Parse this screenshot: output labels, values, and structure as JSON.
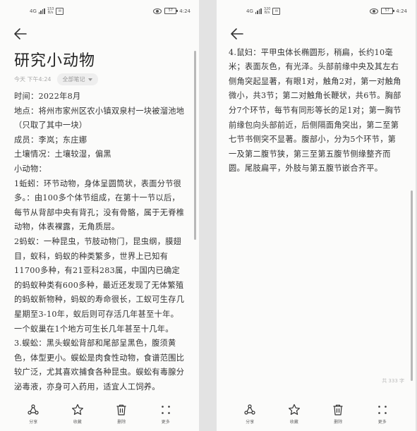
{
  "status": {
    "network": "4G",
    "speed_value": "153",
    "speed_unit": "B/s",
    "speed_value_right": "320",
    "time": "4:24",
    "battery": "57"
  },
  "note": {
    "title": "研究小动物",
    "date": "今天 下午4:24",
    "category": "全部笔记",
    "lines": [
      "时间：2022年8月",
      "地点：将州市家州区农小镇双泉村一块被溜池地（只取了其中一块）",
      "成员：李岚；东庄娜",
      "土壤情况：土壤较湿，偏黑",
      "小动物：",
      "1蚯蚓：环节动物，身体呈圆筒状，表面分节很多。：由100多个体节组成，在第十一节以后，每节从背部中央有背孔；没有骨骼，属于无脊椎动物，体表裸露，无角质层。",
      "2蚂蚁：一种昆虫，节肢动物门，昆虫纲，膜翅目，蚁科，蚂蚁的种类繁多，世界上已知有11700多种，有21亚科283属，中国内已确定的蚂蚁种类有600多种，最近还发现了无体繁殖的蚂蚁新物种，蚂蚁的寿命很长，工蚁可生存几星期至3-10年，蚁后则可存活几年甚至十年。一个蚁巢在1个地方可生长几年甚至十几年。",
      "3.蜈蚣：黑头蜈蚣背部和尾部呈黑色，腹须黄色，体型更小。蜈蚣是肉食性动物，食谱范围比较广泛，尤其喜欢捕食各种昆虫。蜈蚣有毒腺分泌毒液，亦身可入药用，适宜人工饲养。",
      "4.鼠妇：平甲虫体长椭圆形，稍扁，长约10毫米；表面灰色，有光泽。头部前缘中央及其左右侧角突起显著，有眼1对，触角2对，第一对触角微小，共3节；第二对触角长鞭状，共6节。胸部分7个环节，每节有同形等长的足1对；第一胸节前缘包向头部前近，后侧隔面角突出，第二至第七节书侧突不显著。腹部小，分为5个环节，第一及第二腹节狭，第三至第五腹节侧缘整齐而圆。尾肢扁平，外肢与第五腹节嵌合齐平。"
    ],
    "word_count": "共 333 字"
  },
  "toolbar": [
    {
      "id": "share",
      "label": "分享"
    },
    {
      "id": "favorite",
      "label": "收藏"
    },
    {
      "id": "delete",
      "label": "删除"
    },
    {
      "id": "more",
      "label": "更多"
    }
  ],
  "colors": {
    "background": "#fbfbfa",
    "text": "#333333",
    "muted": "#aaaaaa"
  }
}
